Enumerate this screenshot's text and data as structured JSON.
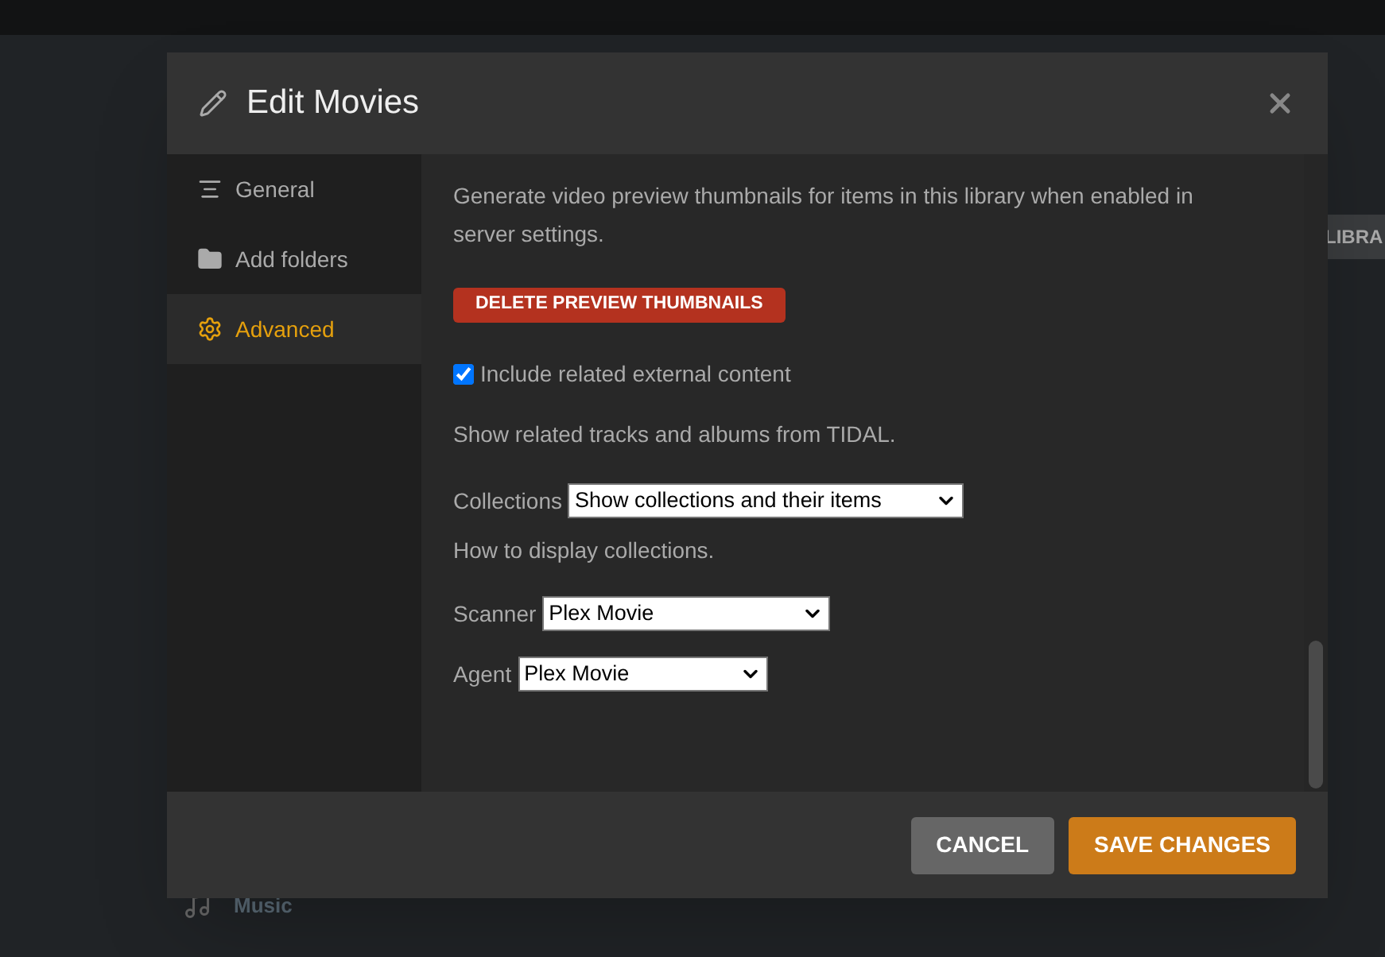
{
  "background": {
    "tag": "LIBRA",
    "nav_item": "Music"
  },
  "dialog": {
    "title": "Edit Movies",
    "sidebar": [
      {
        "label": "General",
        "kind": "general",
        "selected": false
      },
      {
        "label": "Add folders",
        "kind": "folders",
        "selected": false
      },
      {
        "label": "Advanced",
        "kind": "advanced",
        "selected": true
      }
    ],
    "content": {
      "thumbnails_help": "Generate video preview thumbnails for items in this library when enabled in server settings.",
      "delete_button": "DELETE PREVIEW THUMBNAILS",
      "external_content": {
        "label": "Include related external content",
        "checked": true
      },
      "external_help": "Show related tracks and albums from TIDAL.",
      "selects": [
        {
          "label": "Collections",
          "value": "Show collections and their items",
          "help": "How to display collections."
        },
        {
          "label": "Scanner",
          "value": "Plex Movie"
        },
        {
          "label": "Agent",
          "value": "Plex Movie"
        }
      ]
    },
    "buttons": [
      {
        "label": "CANCEL",
        "kind": "secondary"
      },
      {
        "label": "SAVE CHANGES",
        "kind": "primary"
      }
    ]
  }
}
